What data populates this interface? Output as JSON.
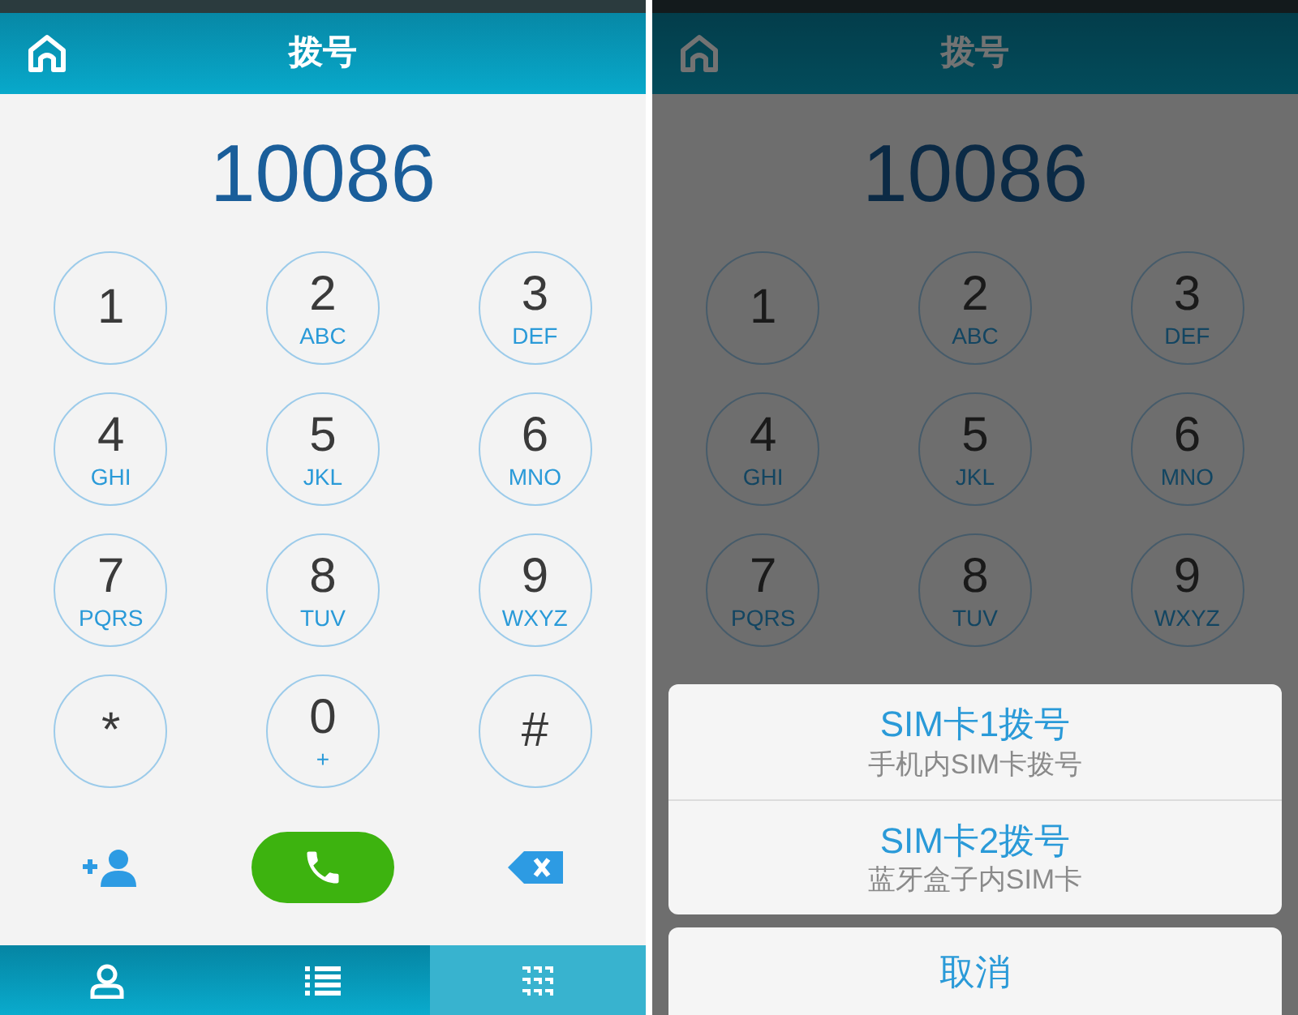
{
  "screens": [
    {
      "dimmed": false,
      "header": {
        "title": "拨号"
      },
      "number": "10086",
      "keys": [
        {
          "digit": "1"
        },
        {
          "digit": "2",
          "letters": "ABC"
        },
        {
          "digit": "3",
          "letters": "DEF"
        },
        {
          "digit": "4",
          "letters": "GHI"
        },
        {
          "digit": "5",
          "letters": "JKL"
        },
        {
          "digit": "6",
          "letters": "MNO"
        },
        {
          "digit": "7",
          "letters": "PQRS"
        },
        {
          "digit": "8",
          "letters": "TUV"
        },
        {
          "digit": "9",
          "letters": "WXYZ"
        },
        {
          "digit": "*"
        },
        {
          "digit": "0",
          "letters": "+"
        },
        {
          "digit": "#"
        }
      ],
      "actions": [
        {
          "kind": "add_contact"
        },
        {
          "kind": "call"
        },
        {
          "kind": "backspace"
        }
      ],
      "tabs": [
        {
          "kind": "contacts",
          "selected": false
        },
        {
          "kind": "log",
          "selected": false
        },
        {
          "kind": "keypad",
          "selected": true
        }
      ]
    },
    {
      "dimmed": true,
      "header": {
        "title": "拨号"
      },
      "number": "10086",
      "keys": [
        {
          "digit": "1"
        },
        {
          "digit": "2",
          "letters": "ABC"
        },
        {
          "digit": "3",
          "letters": "DEF"
        },
        {
          "digit": "4",
          "letters": "GHI"
        },
        {
          "digit": "5",
          "letters": "JKL"
        },
        {
          "digit": "6",
          "letters": "MNO"
        },
        {
          "digit": "7",
          "letters": "PQRS"
        },
        {
          "digit": "8",
          "letters": "TUV"
        },
        {
          "digit": "9",
          "letters": "WXYZ"
        }
      ],
      "action_sheet": {
        "options": [
          {
            "title": "SIM卡1拨号",
            "subtitle": "手机内SIM卡拨号"
          },
          {
            "title": "SIM卡2拨号",
            "subtitle": "蓝牙盒子内SIM卡"
          }
        ],
        "cancel": "取消"
      }
    }
  ]
}
